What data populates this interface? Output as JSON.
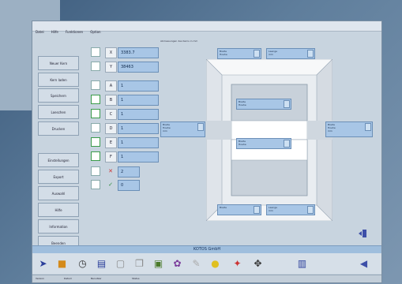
{
  "menu": [
    "Datei",
    "Hilfe",
    "Funktionen",
    "Option"
  ],
  "sidebar": [
    "Neuer Kern",
    "Kern laden",
    "Speichern",
    "Loeschen",
    "Drucken",
    "Einstellungen",
    "Export",
    "Auswahl",
    "Hilfe",
    "Information",
    "Beenden"
  ],
  "rows": [
    {
      "letter": "X",
      "value": "3383.7"
    },
    {
      "letter": "Y",
      "value": "38463"
    },
    {
      "letter": "A",
      "value": "1"
    },
    {
      "letter": "B",
      "value": "1"
    },
    {
      "letter": "C",
      "value": "1"
    },
    {
      "letter": "D",
      "value": "1"
    },
    {
      "letter": "E",
      "value": "1"
    },
    {
      "letter": "F",
      "value": "1"
    }
  ],
  "sub_rows": [
    {
      "value": "2"
    },
    {
      "value": "0"
    }
  ],
  "header_label": "Abmessungen des Kerns in mm",
  "infoboxes": {
    "top_left": {
      "line1": "Breite",
      "line2": "Hoehe"
    },
    "top_right": {
      "line1": "Laenge",
      "line2": "mm"
    },
    "inner_top": {
      "line1": "Breite",
      "line2": "Hoehe"
    },
    "inner_bottom": {
      "line1": "Breite",
      "line2": "Hoehe"
    },
    "left_mid": {
      "line1": "Breite",
      "line2": "Hoehe",
      "line3": "mm"
    },
    "right_mid": {
      "line1": "Breite",
      "line2": "Hoehe",
      "line3": "mm"
    },
    "bottom_left": {
      "line1": "Breite"
    },
    "bottom_right": {
      "line1": "Laenge",
      "line2": "mm"
    }
  },
  "company": "KOTOS GmbH",
  "statusbar": [
    "Version",
    "Datum",
    "Benutzer",
    "Status"
  ],
  "colors": {
    "accent": "#a8c6e6",
    "window_bg": "#c8d4df",
    "status_strip": "#9fbedd"
  },
  "toolbar_icons": [
    "pointer-icon",
    "folder-icon",
    "clock-icon",
    "document-icon",
    "page-icon",
    "copy-icon",
    "image-icon",
    "palette-icon",
    "brush-icon",
    "cursor-icon",
    "pin-icon",
    "expand-icon",
    "save-icon",
    "exit-icon"
  ]
}
